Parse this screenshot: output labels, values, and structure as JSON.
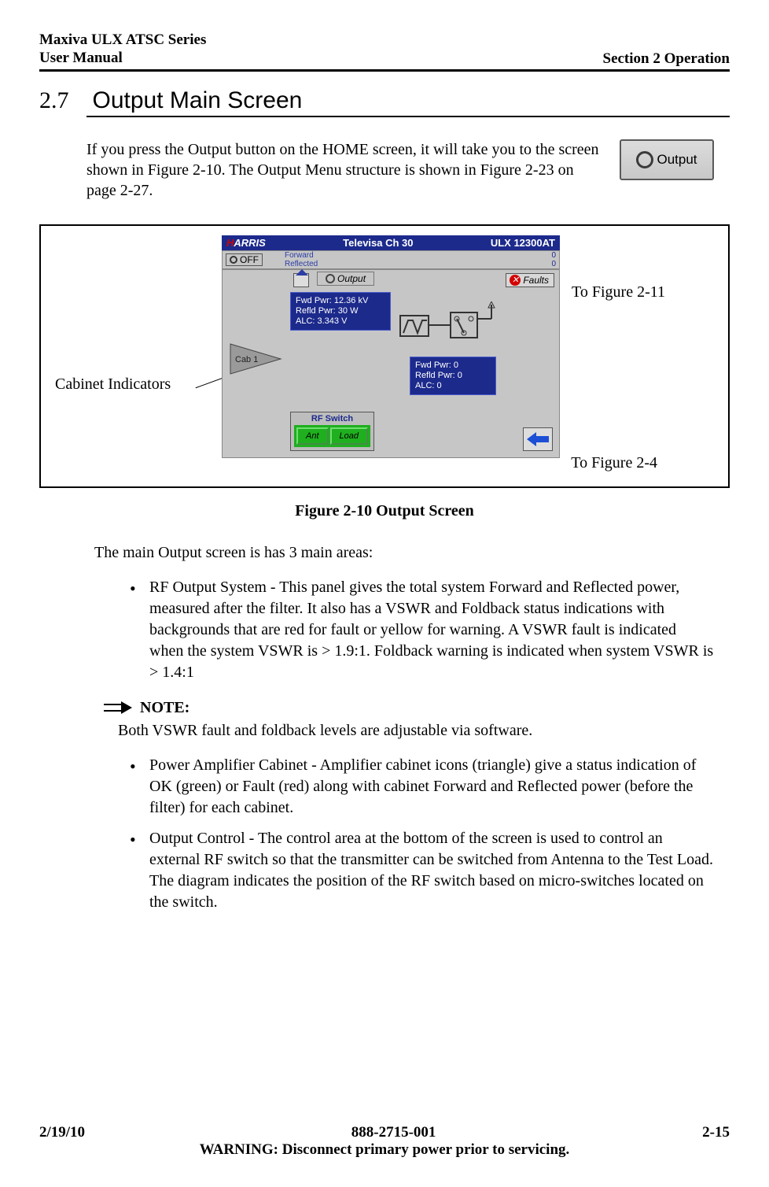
{
  "header": {
    "line1": "Maxiva ULX ATSC Series",
    "line2": "User Manual",
    "section": "Section 2 Operation"
  },
  "title": {
    "num": "2.7",
    "label": "Output Main Screen"
  },
  "intro": "If you press the Output button on the HOME screen, it will take you to the screen shown in Figure 2-10. The Output Menu structure is shown in  Figure 2-23 on page 2-27.",
  "output_button_label": "Output",
  "figure": {
    "label_cabinet": "Cabinet Indicators",
    "label_fig11": "To Figure 2-11",
    "label_fig4": "To Figure 2-4"
  },
  "screenshot": {
    "logo": "HARRIS",
    "title_center": "Televisa Ch 30",
    "title_right": "ULX 12300AT",
    "off": "OFF",
    "fwd_label": "Forward",
    "rfl_label": "Reflected",
    "fwd_val_bar": "0",
    "rfl_val_bar": "0",
    "out_tab": "Output",
    "faults": "Faults",
    "panel1_l1": "Fwd Pwr:  12.36 kV",
    "panel1_l2": "Refld Pwr:   30 W",
    "panel1_l3": "ALC:         3.343 V",
    "cab_label": "Cab 1",
    "panel2_l1": "Fwd Pwr:       0",
    "panel2_l2": "Refld Pwr:     0",
    "panel2_l3": "ALC:            0",
    "rfswitch_label": "RF Switch",
    "ant": "Ant",
    "load": "Load"
  },
  "caption": "Figure 2-10  Output Screen",
  "main_para": " The main Output screen is has 3 main areas:",
  "bullets1": [
    " RF Output System - This panel gives the total system Forward and Reflected power, measured after the filter. It also has a VSWR and Foldback status indications with backgrounds that are red for fault or yellow for warning. A VSWR fault is indicated when the system VSWR is > 1.9:1. Foldback warning is indicated when system VSWR is > 1.4:1"
  ],
  "note": {
    "label": "NOTE:",
    "text": " Both VSWR fault and foldback levels are adjustable via software."
  },
  "bullets2": [
    " Power Amplifier Cabinet - Amplifier cabinet icons (triangle) give a status indication of OK (green) or Fault (red) along with cabinet Forward and Reflected power (before the filter) for each cabinet.",
    " Output Control - The control area at the bottom of the screen is used to control an external RF switch so that the transmitter can be switched from Antenna to the Test Load. The diagram indicates the position of the RF switch based on micro-switches located on the switch."
  ],
  "footer": {
    "date": "2/19/10",
    "docnum": "888-2715-001",
    "page": "2-15",
    "warning": "WARNING: Disconnect primary power prior to servicing."
  }
}
